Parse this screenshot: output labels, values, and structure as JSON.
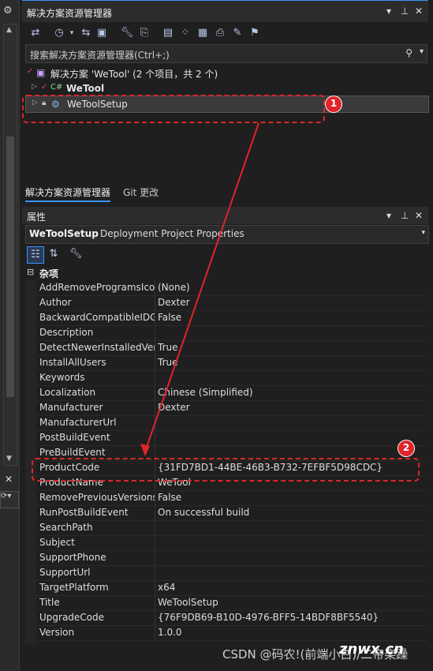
{
  "solution_explorer": {
    "title": "解决方案资源管理器",
    "search_placeholder": "搜索解决方案资源管理器(Ctrl+;)",
    "tree": {
      "solution_label": "解决方案 'WeTool' (2 个项目，共 2 个)",
      "project1": "WeTool",
      "project2": "WeToolSetup"
    },
    "tabs": [
      "解决方案资源管理器",
      "Git 更改"
    ]
  },
  "properties": {
    "title": "属性",
    "object_name": "WeToolSetup",
    "object_type": "Deployment Project Properties",
    "category": "杂项",
    "rows": [
      {
        "key": "AddRemoveProgramsIcon",
        "value": "(None)"
      },
      {
        "key": "Author",
        "value": "Dexter"
      },
      {
        "key": "BackwardCompatibleIDGeneration",
        "value": "False"
      },
      {
        "key": "Description",
        "value": ""
      },
      {
        "key": "DetectNewerInstalledVersion",
        "value": "True"
      },
      {
        "key": "InstallAllUsers",
        "value": "True"
      },
      {
        "key": "Keywords",
        "value": ""
      },
      {
        "key": "Localization",
        "value": "Chinese (Simplified)"
      },
      {
        "key": "Manufacturer",
        "value": "Dexter"
      },
      {
        "key": "ManufacturerUrl",
        "value": ""
      },
      {
        "key": "PostBuildEvent",
        "value": ""
      },
      {
        "key": "PreBuildEvent",
        "value": ""
      },
      {
        "key": "ProductCode",
        "value": "{31FD7BD1-44BE-46B3-B732-7EFBF5D98CDC}"
      },
      {
        "key": "ProductName",
        "value": "WeTool"
      },
      {
        "key": "RemovePreviousVersions",
        "value": "False"
      },
      {
        "key": "RunPostBuildEvent",
        "value": "On successful build"
      },
      {
        "key": "SearchPath",
        "value": ""
      },
      {
        "key": "Subject",
        "value": ""
      },
      {
        "key": "SupportPhone",
        "value": ""
      },
      {
        "key": "SupportUrl",
        "value": ""
      },
      {
        "key": "TargetPlatform",
        "value": "x64"
      },
      {
        "key": "Title",
        "value": "WeToolSetup"
      },
      {
        "key": "UpgradeCode",
        "value": "{76F9DB69-B10D-4976-BFF5-14BDF8BF5540}"
      },
      {
        "key": "Version",
        "value": "1.0.0"
      }
    ]
  },
  "annotations": {
    "badge1": "1",
    "badge2": "2"
  },
  "watermark": {
    "csdn": "CSDN @码农!(前端小白)/二帝楽躁",
    "znwx": "znwx.cn"
  },
  "colors": {
    "accent": "#3794ff",
    "annotation": "#e0242a"
  }
}
